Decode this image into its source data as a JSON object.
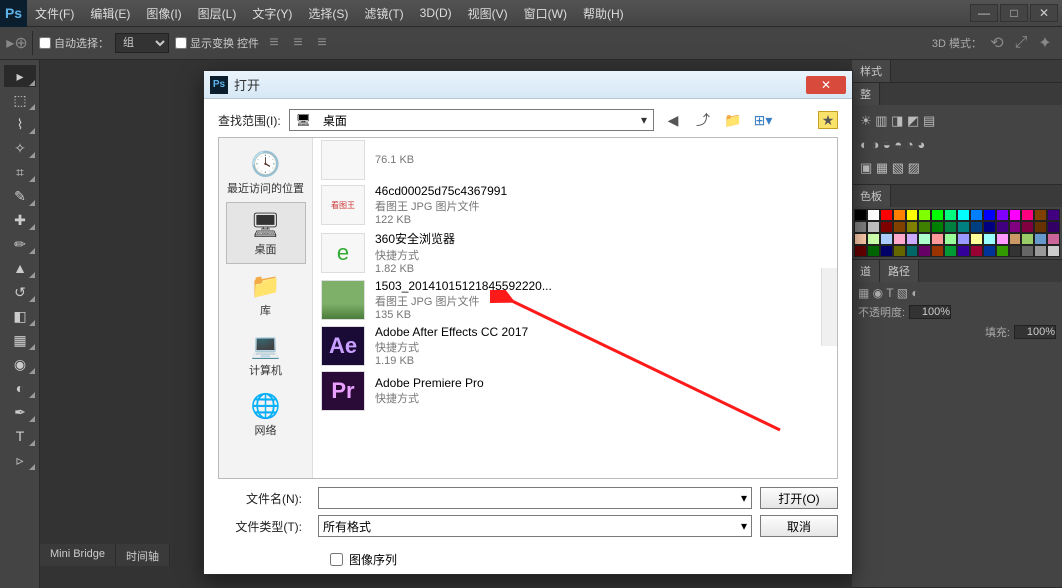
{
  "menubar": {
    "items": [
      "文件(F)",
      "编辑(E)",
      "图像(I)",
      "图层(L)",
      "文字(Y)",
      "选择(S)",
      "滤镜(T)",
      "3D(D)",
      "视图(V)",
      "窗口(W)",
      "帮助(H)"
    ]
  },
  "optbar": {
    "auto_select": "自动选择：",
    "group": "组",
    "show_transform": "显示变换 控件",
    "mode3d": "3D 模式："
  },
  "right": {
    "adjust_tab": "整",
    "style_tab": "样式",
    "color_tab": "色板",
    "channels_tab": "道",
    "paths_tab": "路径",
    "opacity_label": "不透明度:",
    "opacity_value": "100%",
    "fill_label": "填充:",
    "fill_value": "100%"
  },
  "bottom": {
    "tabs": [
      "Mini Bridge",
      "时间轴"
    ]
  },
  "dialog": {
    "title": "打开",
    "look_in_label": "查找范围(I):",
    "look_in_value": "桌面",
    "places": [
      {
        "label": "最近访问的位置"
      },
      {
        "label": "桌面"
      },
      {
        "label": "库"
      },
      {
        "label": "计算机"
      },
      {
        "label": "网络"
      }
    ],
    "files": [
      {
        "name": "",
        "type": "",
        "size": "76.1 KB"
      },
      {
        "name": "46cd00025d75c4367991",
        "type": "看图王 JPG 图片文件",
        "size": "122 KB"
      },
      {
        "name": "360安全浏览器",
        "type": "快捷方式",
        "size": "1.82 KB"
      },
      {
        "name": "1503_20141015121845592220...",
        "type": "看图王 JPG 图片文件",
        "size": "135 KB"
      },
      {
        "name": "Adobe After Effects CC 2017",
        "type": "快捷方式",
        "size": "1.19 KB"
      },
      {
        "name": "Adobe Premiere Pro",
        "type": "快捷方式",
        "size": ""
      }
    ],
    "filename_label": "文件名(N):",
    "filename_value": "",
    "filetype_label": "文件类型(T):",
    "filetype_value": "所有格式",
    "open_btn": "打开(O)",
    "cancel_btn": "取消",
    "image_sequence": "图像序列"
  },
  "swatch_colors": [
    "#000000",
    "#ffffff",
    "#ff0000",
    "#ff7f00",
    "#ffff00",
    "#7fff00",
    "#00ff00",
    "#00ff7f",
    "#00ffff",
    "#007fff",
    "#0000ff",
    "#7f00ff",
    "#ff00ff",
    "#ff007f",
    "#804000",
    "#400080",
    "#808080",
    "#c0c0c0",
    "#800000",
    "#804000",
    "#808000",
    "#408000",
    "#008000",
    "#008040",
    "#008080",
    "#004080",
    "#000080",
    "#400080",
    "#800080",
    "#800040",
    "#663300",
    "#330066",
    "#fca",
    "#cfa",
    "#acf",
    "#fac",
    "#caf",
    "#afc",
    "#f99",
    "#9f9",
    "#99f",
    "#ff9",
    "#9ff",
    "#f9f",
    "#c96",
    "#9c6",
    "#69c",
    "#c69",
    "#600",
    "#060",
    "#006",
    "#660",
    "#066",
    "#606",
    "#930",
    "#093",
    "#309",
    "#903",
    "#039",
    "#390",
    "#333",
    "#666",
    "#999",
    "#ccc"
  ]
}
